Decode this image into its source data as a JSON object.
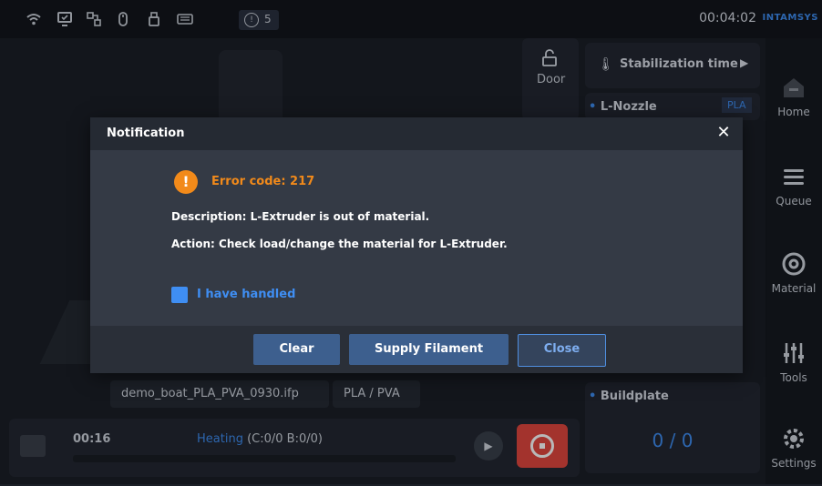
{
  "status_bar": {
    "alert_count": "5",
    "clock": "00:04:02",
    "brand": "INTAMSYS"
  },
  "sidebar": {
    "items": [
      {
        "label": "Home",
        "icon": "home-icon"
      },
      {
        "label": "Queue",
        "icon": "queue-icon"
      },
      {
        "label": "Material",
        "icon": "material-icon"
      },
      {
        "label": "Tools",
        "icon": "tools-icon"
      },
      {
        "label": "Settings",
        "icon": "settings-icon"
      }
    ],
    "active": "Home"
  },
  "door": {
    "label": "Door"
  },
  "stabilization": {
    "label": "Stabilization time"
  },
  "l_nozzle": {
    "label": "L-Nozzle",
    "material": "PLA"
  },
  "buildplate": {
    "label": "Buildplate",
    "value": "0 / 0"
  },
  "job": {
    "filename": "demo_boat_PLA_PVA_0930.ifp",
    "materials": "PLA / PVA",
    "elapsed": "00:16",
    "status_label": "Heating",
    "status_value": "(C:0/0 B:0/0)",
    "progress_fraction": 0
  },
  "modal": {
    "title": "Notification",
    "error_code": "Error code: 217",
    "description": "Description: L-Extruder is out of material.",
    "action": "Action: Check load/change the material for L-Extruder.",
    "checkbox_label": "I have handled",
    "buttons": {
      "clear": "Clear",
      "supply": "Supply Filament",
      "close": "Close"
    }
  },
  "colors": {
    "accent": "#3f8ef3",
    "warning": "#f28a1a",
    "stop": "#e2473f"
  }
}
